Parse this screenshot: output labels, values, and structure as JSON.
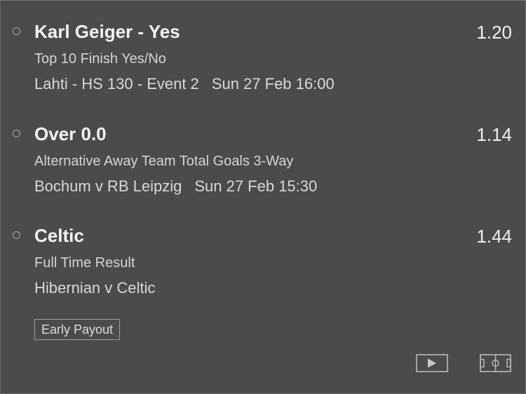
{
  "selections": [
    {
      "name": "Karl Geiger - Yes",
      "odds": "1.20",
      "market": "Top 10 Finish Yes/No",
      "event": "Lahti - HS 130 - Event 2",
      "time": "Sun 27 Feb 16:00"
    },
    {
      "name": "Over 0.0",
      "odds": "1.14",
      "market": "Alternative Away Team Total Goals 3-Way",
      "event": "Bochum v RB Leipzig",
      "time": "Sun 27 Feb 15:30"
    },
    {
      "name": "Celtic",
      "odds": "1.44",
      "market": "Full Time Result",
      "event": "Hibernian v Celtic",
      "time": ""
    }
  ],
  "badge": {
    "label": "Early Payout"
  },
  "actions": {
    "play_icon": "play-video-icon",
    "pitch_icon": "match-pitch-icon"
  },
  "colors": {
    "background": "#4a4a4a",
    "text_primary": "#f4f4f4",
    "text_secondary": "#d4d4d4",
    "border": "#9c9c9c"
  }
}
